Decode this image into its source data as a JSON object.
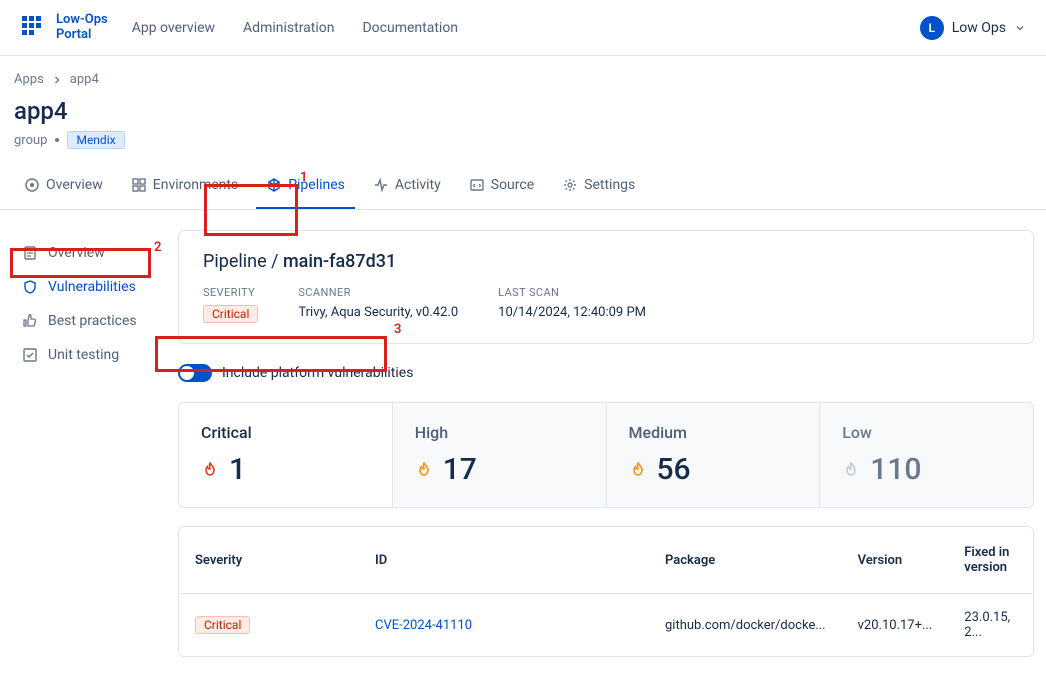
{
  "header": {
    "logo_line1": "Low-Ops",
    "logo_line2": "Portal",
    "nav": [
      "App overview",
      "Administration",
      "Documentation"
    ],
    "user_initial": "L",
    "user_name": "Low Ops"
  },
  "breadcrumb": {
    "root": "Apps",
    "current": "app4"
  },
  "page": {
    "title": "app4",
    "group": "group",
    "engine": "Mendix"
  },
  "tabs": [
    "Overview",
    "Environments",
    "Pipelines",
    "Activity",
    "Source",
    "Settings"
  ],
  "sidebar": [
    "Overview",
    "Vulnerabilities",
    "Best practices",
    "Unit testing"
  ],
  "pipeline": {
    "prefix": "Pipeline /",
    "name": "main-fa87d31",
    "meta": {
      "severity_label": "SEVERITY",
      "severity_value": "Critical",
      "scanner_label": "SCANNER",
      "scanner_value": "Trivy, Aqua Security, v0.42.0",
      "lastscan_label": "LAST SCAN",
      "lastscan_value": "10/14/2024, 12:40:09 PM"
    }
  },
  "toggle_label": "Include platform vulnerabilities",
  "stats": {
    "critical": {
      "label": "Critical",
      "value": "1",
      "color": "#DE350B"
    },
    "high": {
      "label": "High",
      "value": "17",
      "color": "#FF8B00"
    },
    "medium": {
      "label": "Medium",
      "value": "56",
      "color": "#FF8B00"
    },
    "low": {
      "label": "Low",
      "value": "110",
      "color": "#C1C7D0"
    }
  },
  "table": {
    "headers": [
      "Severity",
      "ID",
      "Package",
      "Version",
      "Fixed in version"
    ],
    "rows": [
      {
        "severity": "Critical",
        "id": "CVE-2024-41110",
        "package": "github.com/docker/docke...",
        "version": "v20.10.17+...",
        "fixed": "23.0.15, 2..."
      }
    ]
  },
  "annotations": {
    "a1": "1",
    "a2": "2",
    "a3": "3"
  }
}
